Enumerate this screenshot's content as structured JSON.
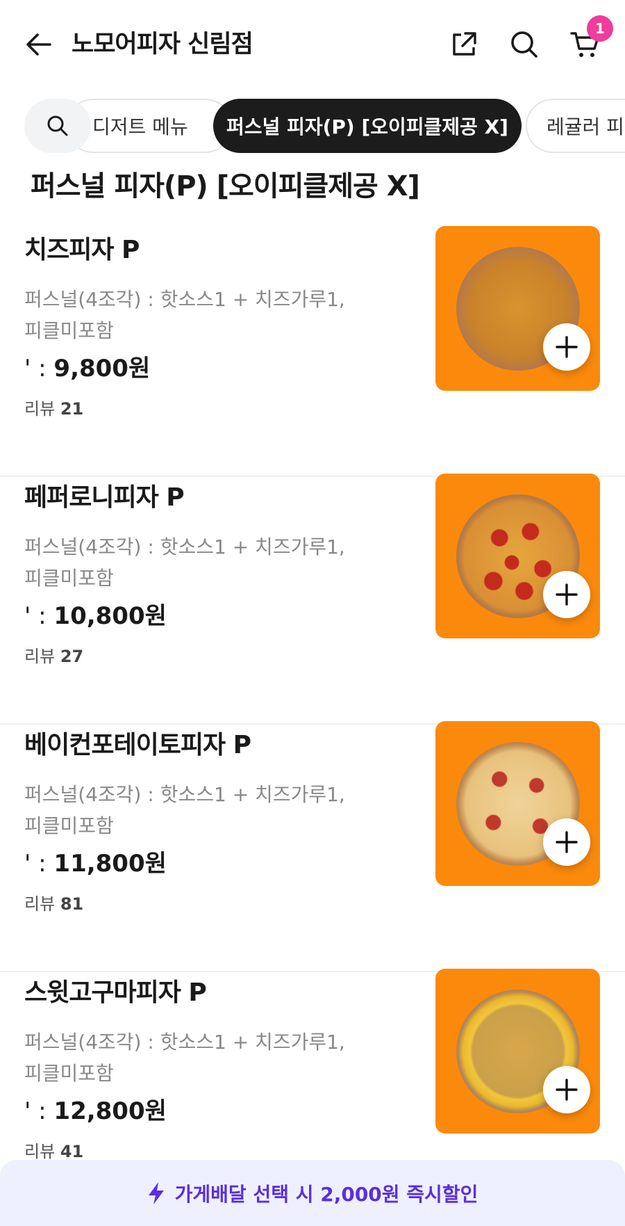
{
  "header": {
    "title": "노모어피자 신림점",
    "cart_count": "1",
    "icons": [
      "back-arrow-icon",
      "share-icon",
      "search-icon",
      "cart-icon"
    ]
  },
  "tabs": [
    {
      "label": "디저트 메뉴",
      "active": false
    },
    {
      "label": "퍼스널 피자(P) [오이피클제공 X]",
      "active": true
    },
    {
      "label": "레귤러 피자",
      "active": false
    }
  ],
  "section_title": "퍼스널 피자(P) [오이피클제공 X]",
  "items": [
    {
      "name": "치즈피자 P",
      "desc": "퍼스널(4조각) : 핫소스1 + 치즈가루1, 피클미포함",
      "price_prefix": "' : ",
      "price": "9,800원",
      "review_label": "리뷰",
      "review_count": "21",
      "pizza": "cheese"
    },
    {
      "name": "페퍼로니피자 P",
      "desc": "퍼스널(4조각) : 핫소스1 + 치즈가루1, 피클미포함",
      "price_prefix": "' : ",
      "price": "10,800원",
      "review_label": "리뷰",
      "review_count": "27",
      "pizza": "pepperoni"
    },
    {
      "name": "베이컨포테이토피자 P",
      "desc": "퍼스널(4조각) : 핫소스1 + 치즈가루1, 피클미포함",
      "price_prefix": "' : ",
      "price": "11,800원",
      "review_label": "리뷰",
      "review_count": "81",
      "pizza": "bacon"
    },
    {
      "name": "스윗고구마피자 P",
      "desc": "퍼스널(4조각) : 핫소스1 + 치즈가루1, 피클미포함",
      "price_prefix": "' : ",
      "price": "12,800원",
      "review_label": "리뷰",
      "review_count": "41",
      "pizza": "sweetpotato"
    }
  ],
  "banner": {
    "text": "가게배달 선택 시 2,000원 즉시할인",
    "icon": "lightning-icon"
  },
  "colors": {
    "accent": "#5a2ee0",
    "badge": "#ee3d9a",
    "thumb_bg": "#fb8a0c",
    "active_tab": "#1c1c1c"
  }
}
